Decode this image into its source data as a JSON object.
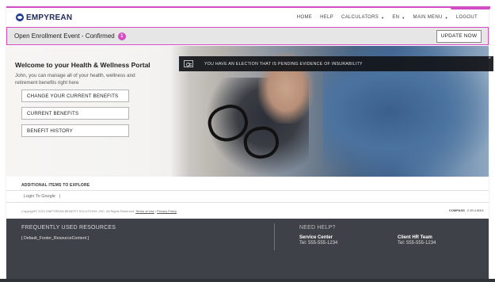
{
  "brand": {
    "name": "EMPYREAN"
  },
  "nav": {
    "items": [
      {
        "label": "HOME",
        "dropdown": false
      },
      {
        "label": "HELP",
        "dropdown": false
      },
      {
        "label": "CALCULATORS",
        "dropdown": true
      },
      {
        "label": "EN",
        "dropdown": true
      },
      {
        "label": "MAIN MENU",
        "dropdown": true
      },
      {
        "label": "LOGOUT",
        "dropdown": false
      }
    ]
  },
  "banner": {
    "title": "Open Enrollment Event - Confirmed",
    "badge_count": "1",
    "button_label": "UPDATE NOW"
  },
  "portal": {
    "welcome": "Welcome to your Health & Wellness Portal",
    "intro": "John, you can manage all of your health, wellness and retirement benefits right here",
    "buttons": [
      {
        "label": "CHANGE YOUR CURRENT BENEFITS"
      },
      {
        "label": "CURRENT BENEFITS"
      },
      {
        "label": "BENEFIT HISTORY"
      }
    ]
  },
  "alert": {
    "text": "YOU HAVE AN ELECTION THAT IS PENDING EVIDENCE OF INSURABILITY",
    "close": "×"
  },
  "explore": {
    "label": "ADDITIONAL ITEMS TO EXPLORE",
    "link": "Login To Google",
    "sep": "|"
  },
  "legal": {
    "copyright": "Copyright© 2021 EMPYREAN BENEFIT SOLUTIONS, INC. All Rights Reserved.",
    "terms": "Terms of Use",
    "sep": "|",
    "privacy": "Privacy Policy",
    "compass_brand": "COMPASS",
    "version": "2.39.4.8001"
  },
  "footer": {
    "resources_heading": "FREQUENTLY USED RESOURCES",
    "resources_content": "[ Default_Footer_ResourceContent ]",
    "help_heading": "NEED HELP?",
    "contacts": [
      {
        "name": "Service Center",
        "tel": "Tel: 555-555-1234"
      },
      {
        "name": "Client HR Team",
        "tel": "Tel: 555-555-1234"
      }
    ]
  },
  "colors": {
    "accent": "#d24cc4",
    "brand_navy": "#1f2a5c",
    "footer_bg": "#3e4248"
  }
}
